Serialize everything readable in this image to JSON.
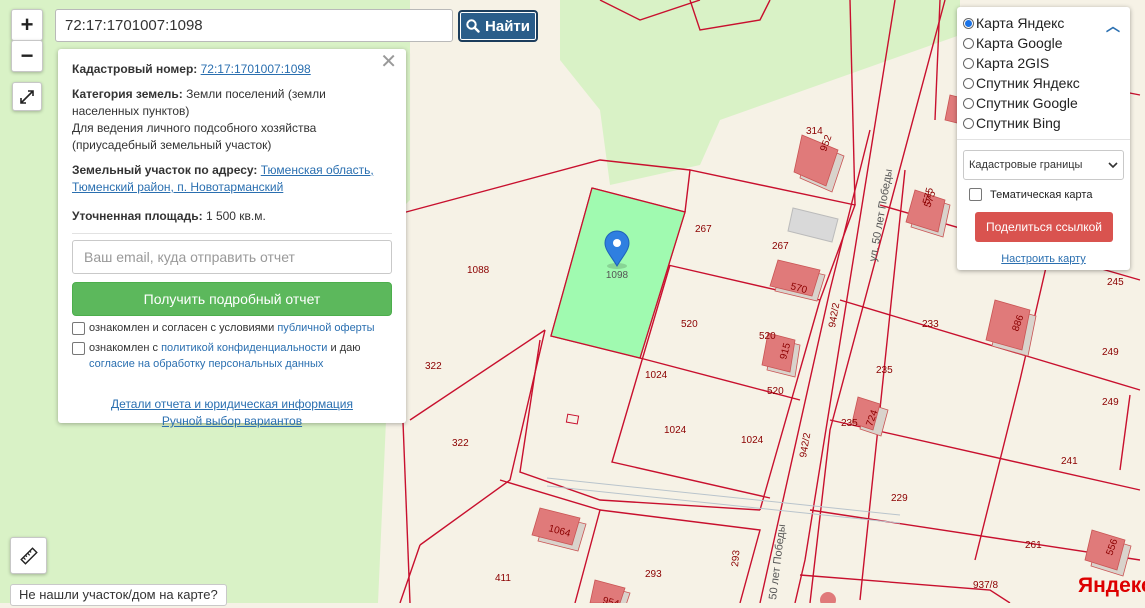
{
  "search": {
    "value": "72:17:1701007:1098",
    "button_label": "Найти"
  },
  "zoom": {
    "in_label": "+",
    "out_label": "−"
  },
  "popup": {
    "cad_label": "Кадастровый номер:",
    "cad_value": "72:17:1701007:1098",
    "cat_label": "Категория земель:",
    "cat_value": "Земли поселений (земли населенных пунктов)",
    "use_value": "Для ведения личного подсобного хозяйства (приусадебный земельный участок)",
    "addr_label": "Земельный участок по адресу:",
    "addr_value": "Тюменская область, Тюменский район, п. Новотарманский",
    "area_label": "Уточненная площадь:",
    "area_value": "1 500 кв.м.",
    "email_placeholder": "Ваш email, куда отправить отчет",
    "report_button": "Получить подробный отчет",
    "agree1_pre": "ознакомлен и согласен с условиями",
    "agree1_link": "публичной оферты",
    "agree2_pre": "ознакомлен с",
    "agree2_link1": "политикой конфиденциальности",
    "agree2_mid": "и даю",
    "agree2_link2": "согласие на обработку персональных данных",
    "link_details": "Детали отчета и юридическая информация",
    "link_manual": "Ручной выбор вариантов"
  },
  "layers": {
    "options": [
      "Карта Яндекс",
      "Карта Google",
      "Карта 2GIS",
      "Спутник Яндекс",
      "Спутник Google",
      "Спутник Bing"
    ],
    "selected_index": 0,
    "dropdown_value": "Кадастровые границы",
    "thematic_label": "Тематическая карта",
    "share_button": "Поделиться ссылкой",
    "configure_link": "Настроить карту"
  },
  "not_found": "Не нашли участок/дом на карте?",
  "logo": "Яндекс",
  "map": {
    "selected_parcel": "1098",
    "parcel_labels": [
      "1088",
      "322",
      "322",
      "267",
      "267",
      "520",
      "520",
      "520",
      "1024",
      "1024",
      "1024",
      "314",
      "575",
      "233",
      "235",
      "235",
      "245",
      "249",
      "249",
      "241",
      "229",
      "261",
      "293",
      "293",
      "411",
      "937/8",
      "942/2",
      "942/2"
    ],
    "house_labels": [
      "952",
      "575",
      "570",
      "915",
      "886",
      "724",
      "1064",
      "556",
      "954"
    ],
    "street_labels": [
      "ул. 50 лет Победы",
      "50 лет Победы"
    ]
  },
  "colors": {
    "parcel_line": "#c8102e",
    "selected_fill": "#90fca6",
    "green": "#d9f2c6",
    "house": "#e07a7a",
    "button_blue": "#2a5d8a",
    "report_green": "#5cb85c",
    "share_red": "#d9534f"
  }
}
